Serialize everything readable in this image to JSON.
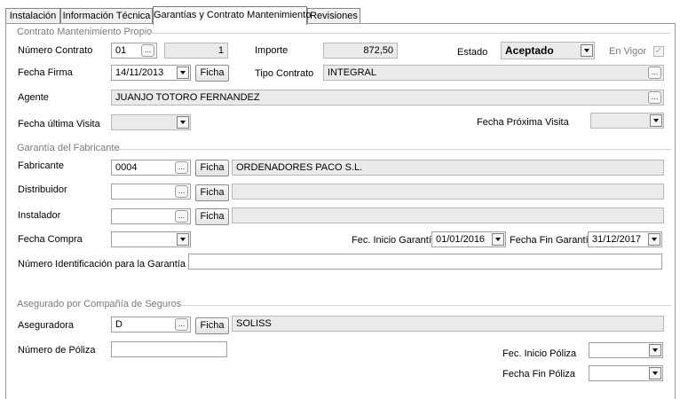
{
  "tabs": [
    "Instalación",
    "Información Técnica",
    "Garantías y Contrato Mantenimiento",
    "Revisiones"
  ],
  "active_tab": 2,
  "contract": {
    "section_title": "Contrato Mantenimiento Propio",
    "numero_label": "Número Contrato",
    "numero_serie": "01",
    "numero_value": "1",
    "importe_label": "Importe",
    "importe_value": "872,50",
    "estado_label": "Estado",
    "estado_value": "Aceptado",
    "vigor_label": "En Vigor",
    "vigor_checked": true,
    "fecha_firma_label": "Fecha Firma",
    "fecha_firma_value": "14/11/2013",
    "tipo_label": "Tipo Contrato",
    "tipo_value": "INTEGRAL",
    "agente_label": "Agente",
    "agente_value": "JUANJO TOTORO FERNANDEZ",
    "fecha_ultima_label": "Fecha última Visita",
    "fecha_ultima_value": "",
    "fecha_proxima_label": "Fecha Próxima Visita",
    "fecha_proxima_value": ""
  },
  "warranty": {
    "section_title": "Garantía del Fabricante",
    "fabricante_label": "Fabricante",
    "fabricante_code": "0004",
    "fabricante_name": "ORDENADORES PACO S.L.",
    "distribuidor_label": "Distribuidor",
    "distribuidor_code": "",
    "distribuidor_name": "",
    "instalador_label": "Instalador",
    "instalador_code": "",
    "instalador_name": "",
    "fecha_compra_label": "Fecha Compra",
    "fecha_compra_value": "",
    "inicio_label": "Fec. Inicio Garantía",
    "inicio_value": "01/01/2016",
    "fin_label": "Fecha Fin Garantía",
    "fin_value": "31/12/2017",
    "numero_id_label": "Número Identificación para la Garantía",
    "numero_id_value": ""
  },
  "insurance": {
    "section_title": "Asegurado por Compañía de Seguros",
    "aseguradora_label": "Aseguradora",
    "aseguradora_code": "D",
    "aseguradora_name": "SOLISS",
    "poliza_label": "Número de Póliza",
    "poliza_value": "",
    "inicio_poliza_label": "Fec. Inicio Póliza",
    "inicio_poliza_value": "",
    "fin_poliza_label": "Fecha Fin Póliza",
    "fin_poliza_value": ""
  },
  "buttons": {
    "ficha": "Ficha",
    "ellipsis": "..."
  },
  "icons": {
    "dropdown": "chevron-down-icon",
    "check": "check-icon"
  }
}
